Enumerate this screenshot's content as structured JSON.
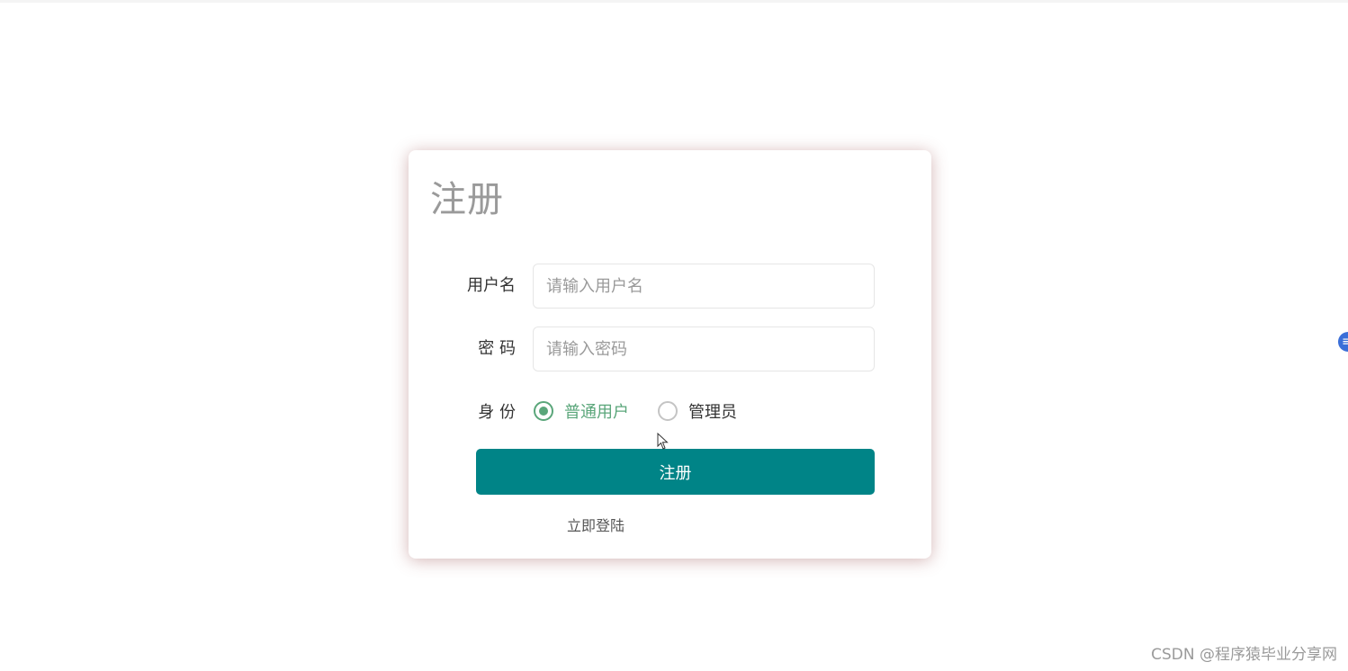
{
  "form": {
    "title": "注册",
    "username_label": "用户名",
    "username_placeholder": "请输入用户名",
    "username_value": "",
    "password_label": "密 码",
    "password_placeholder": "请输入密码",
    "password_value": "",
    "role_label": "身 份",
    "roles": [
      {
        "label": "普通用户",
        "checked": true
      },
      {
        "label": "管理员",
        "checked": false
      }
    ],
    "submit_label": "注册",
    "login_link": "立即登陆"
  },
  "side_widget": {
    "text": "≡"
  },
  "watermark": "CSDN @程序猿毕业分享网",
  "colors": {
    "accent": "#008487",
    "radio_checked": "#5aa67a",
    "title": "#9a9a9a"
  }
}
